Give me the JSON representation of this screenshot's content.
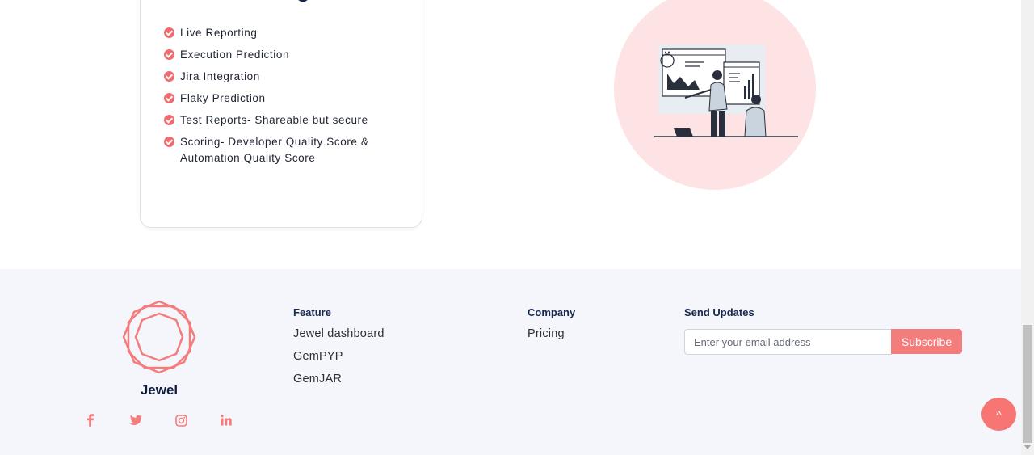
{
  "features": {
    "items": [
      "Live Reporting",
      "Execution Prediction",
      "Jira Integration",
      "Flaky Prediction",
      "Test Reports- Shareable but secure",
      "Scoring- Developer Quality Score & Automation Quality Score"
    ]
  },
  "footer": {
    "brand": "Jewel",
    "feature": {
      "title": "Feature",
      "links": [
        "Jewel dashboard",
        "GemPYP",
        "GemJAR"
      ]
    },
    "company": {
      "title": "Company",
      "links": [
        "Pricing"
      ]
    },
    "updates": {
      "title": "Send Updates",
      "placeholder": "Enter your email address",
      "button": "Subscribe"
    },
    "social": [
      "facebook-icon",
      "twitter-icon",
      "instagram-icon",
      "linkedin-icon"
    ],
    "back_to_top": "^"
  },
  "colors": {
    "accent": "#f37c7c",
    "footer_bg": "#f5f6fb",
    "circle_bg": "#fde3e4",
    "heading": "#15284d"
  }
}
